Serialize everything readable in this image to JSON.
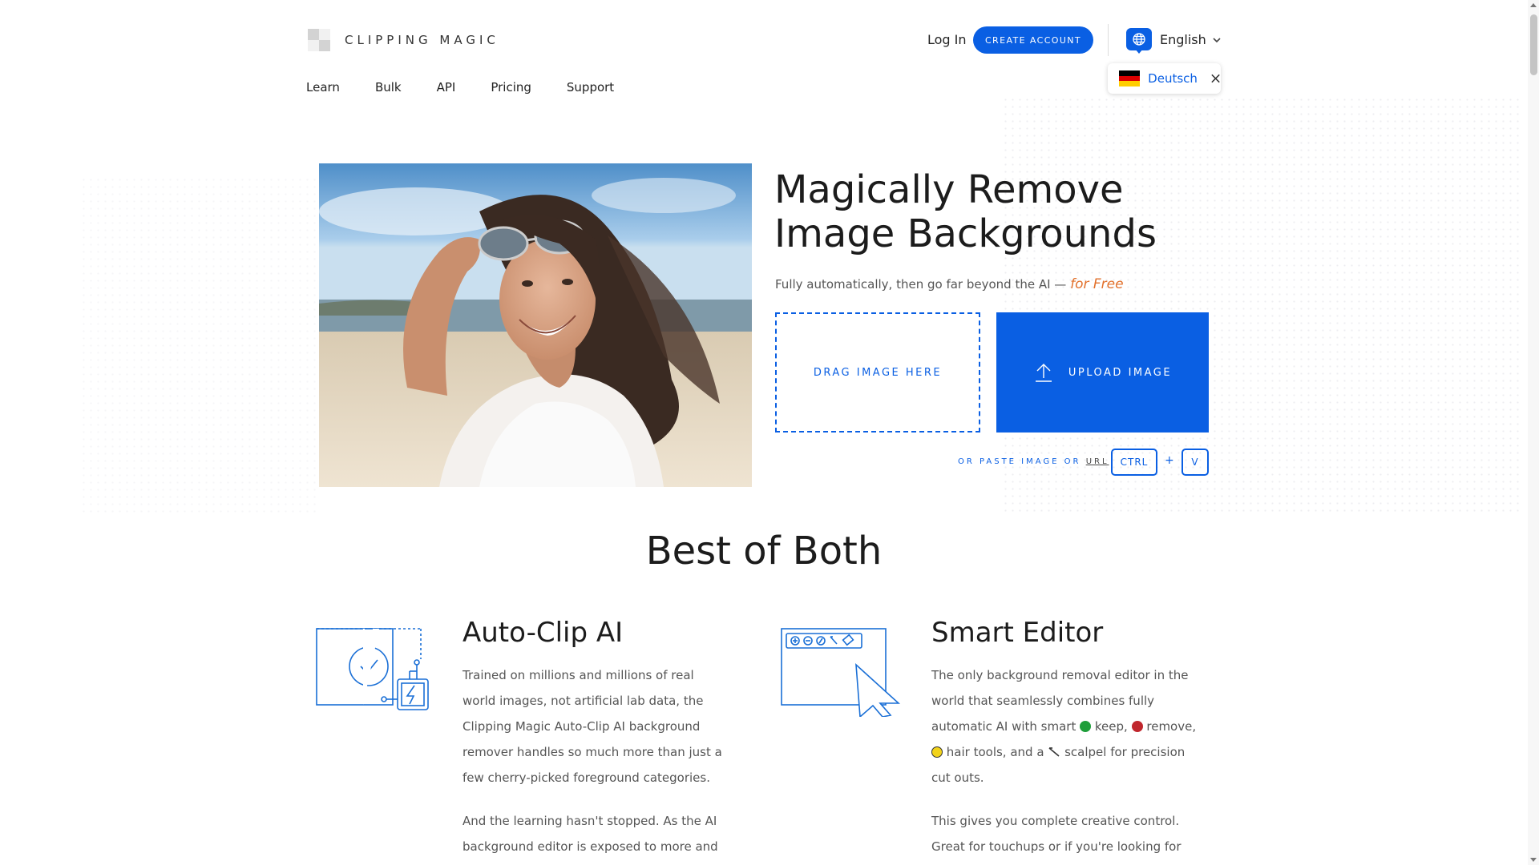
{
  "brand": {
    "name": "CLIPPING MAGIC"
  },
  "nav": {
    "items": [
      "Learn",
      "Bulk",
      "API",
      "Pricing",
      "Support"
    ]
  },
  "header": {
    "login_label": "Log In",
    "create_account_label": "CREATE ACCOUNT",
    "language": "English",
    "language_suggestion": "Deutsch"
  },
  "hero": {
    "title": "Magically Remove Image Backgrounds",
    "subtitle": "Fully automatically, then go far beyond the AI —",
    "subtitle_emphasis": "for Free",
    "drag_label": "DRAG IMAGE HERE",
    "upload_label": "UPLOAD IMAGE",
    "paste_label": "OR PASTE IMAGE OR",
    "paste_url": "URL",
    "key_ctrl": "CTRL",
    "key_plus": "+",
    "key_v": "V"
  },
  "section": {
    "title": "Best of Both"
  },
  "features": {
    "autoclip": {
      "title": "Auto-Clip AI",
      "p1": "Trained on millions and millions of real world images, not artificial lab data, the Clipping Magic Auto-Clip AI background remover handles so much more than just a few cherry-picked foreground categories.",
      "p2": "And the learning hasn't stopped. As the AI background editor is exposed to more and"
    },
    "editor": {
      "title": "Smart Editor",
      "p1_a": "The only background removal editor in the world that seamlessly combines fully automatic AI with smart",
      "keep": "keep,",
      "remove": "remove,",
      "hair": "hair tools, and a",
      "scalpel": "scalpel for precision cut outs.",
      "p2": "This gives you complete creative control. Great for touchups or if you're looking for"
    }
  },
  "colors": {
    "accent": "#0a5fe3",
    "emphasis": "#e2702b",
    "keep": "#1e9e3a",
    "remove": "#c0262d",
    "hair": "#f2d31b"
  }
}
